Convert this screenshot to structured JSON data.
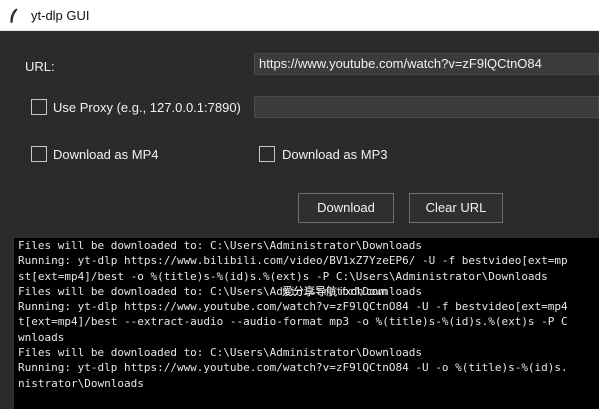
{
  "window": {
    "title": "yt-dlp GUI"
  },
  "form": {
    "url_label": "URL:",
    "url_value": "https://www.youtube.com/watch?v=zF9lQCtnO84",
    "proxy_label": "Use Proxy (e.g., 127.0.0.1:7890)",
    "proxy_value": "",
    "mp4_label": "Download as MP4",
    "mp3_label": "Download as MP3",
    "use_proxy_checked": false,
    "mp4_checked": false,
    "mp3_checked": false
  },
  "buttons": {
    "download": "Download",
    "clear_url": "Clear URL"
  },
  "log": {
    "lines": [
      "Files will be downloaded to: C:\\Users\\Administrator\\Downloads",
      "Running: yt-dlp https://www.bilibili.com/video/BV1xZ7YzeEP6/ -U -f bestvideo[ext=mp",
      "st[ext=mp4]/best -o %(title)s-%(id)s.%(ext)s -P C:\\Users\\Administrator\\Downloads",
      "Files will be downloaded to: C:\\Users\\Administrator\\Downloads",
      "Running: yt-dlp https://www.youtube.com/watch?v=zF9lQCtnO84 -U -f bestvideo[ext=mp4",
      "t[ext=mp4]/best --extract-audio --audio-format mp3 -o %(title)s-%(id)s.%(ext)s -P C",
      "wnloads",
      "Files will be downloaded to: C:\\Users\\Administrator\\Downloads",
      "Running: yt-dlp https://www.youtube.com/watch?v=zF9lQCtnO84 -U -o %(title)s-%(id)s.",
      "nistrator\\Downloads"
    ]
  },
  "watermark": {
    "text": "爱分享导航 ifxdh.com"
  },
  "colors": {
    "background": "#2b2b2b",
    "log_background": "#000000",
    "text": "#f2f2f2"
  }
}
